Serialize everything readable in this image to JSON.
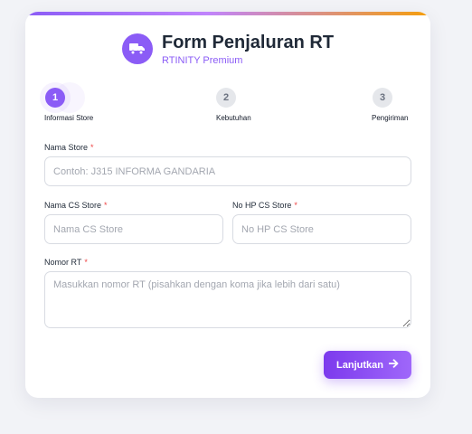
{
  "header": {
    "title": "Form Penjaluran RT",
    "subtitle": "RTINITY Premium",
    "logo_icon": "truck-icon"
  },
  "steps": [
    {
      "number": "1",
      "label": "Informasi Store",
      "active": true
    },
    {
      "number": "2",
      "label": "Kebutuhan",
      "active": false
    },
    {
      "number": "3",
      "label": "Pengiriman",
      "active": false
    }
  ],
  "form": {
    "store_name": {
      "label": "Nama Store",
      "required_mark": "*",
      "placeholder": "Contoh: J315 INFORMA GANDARIA",
      "value": ""
    },
    "cs_name": {
      "label": "Nama CS Store",
      "required_mark": "*",
      "placeholder": "Nama CS Store",
      "value": ""
    },
    "cs_phone": {
      "label": "No HP CS Store",
      "required_mark": "*",
      "placeholder": "No HP CS Store",
      "value": ""
    },
    "rt_number": {
      "label": "Nomor RT",
      "required_mark": "*",
      "placeholder": "Masukkan nomor RT (pisahkan dengan koma jika lebih dari satu)",
      "value": ""
    }
  },
  "actions": {
    "next_label": "Lanjutkan",
    "next_icon": "arrow-right-icon"
  },
  "colors": {
    "accent": "#8b5cf6",
    "required": "#ef4444",
    "background": "#f2f3f7"
  }
}
